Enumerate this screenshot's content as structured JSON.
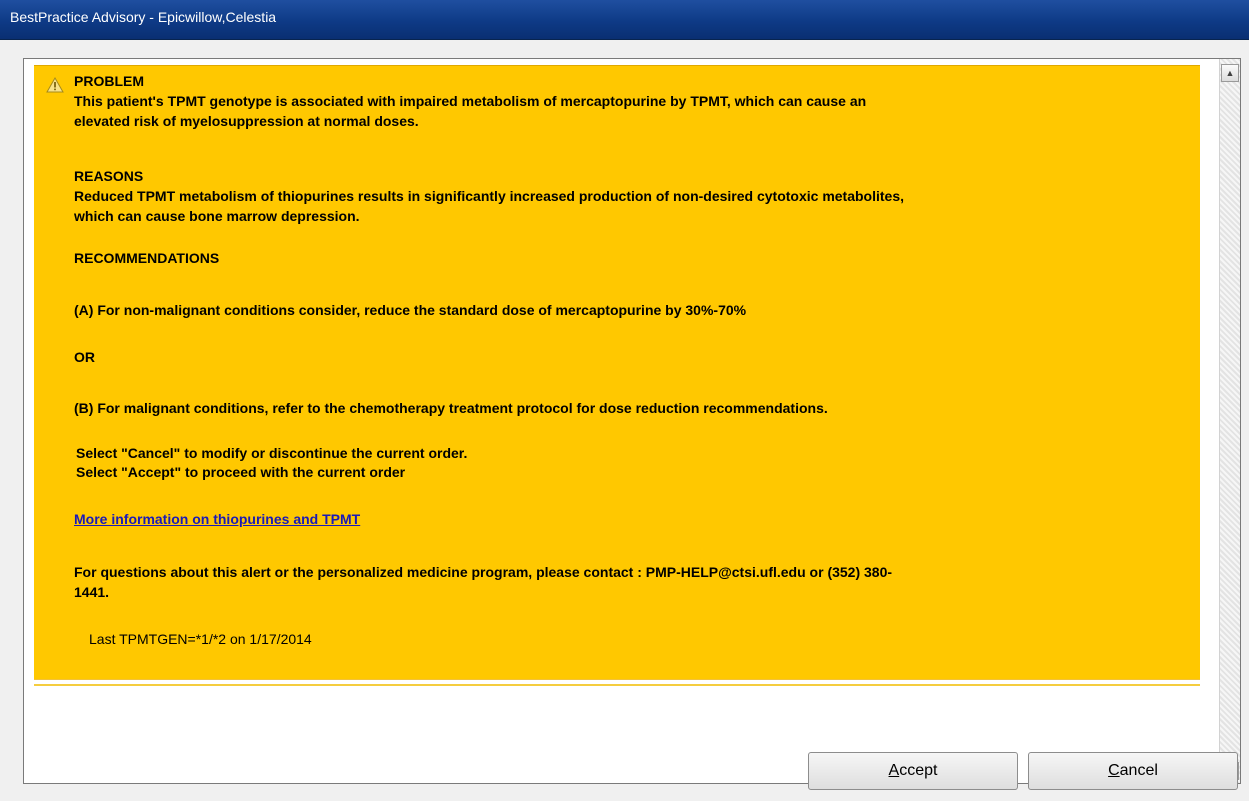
{
  "window": {
    "title": "BestPractice Advisory  - Epicwillow,Celestia"
  },
  "advisory": {
    "problem_heading": "PROBLEM",
    "problem_line1": "This patient's TPMT genotype is associated with impaired metabolism of mercaptopurine by TPMT, which can cause an",
    "problem_line2": "elevated risk of myelosuppression at normal doses.",
    "reasons_heading": "REASONS",
    "reasons_line1": "Reduced TPMT metabolism of thiopurines results in significantly increased production of non-desired cytotoxic metabolites,",
    "reasons_line2": "which can cause bone marrow depression.",
    "recommendations_heading": "RECOMMENDATIONS",
    "rec_a": "(A) For non-malignant conditions consider, reduce the standard dose of mercaptopurine by 30%-70%",
    "or_text": "OR",
    "rec_b": "(B) For malignant conditions, refer to the chemotherapy treatment protocol for dose reduction recommendations.",
    "select_cancel": "Select \"Cancel\" to modify or discontinue the current order.",
    "select_accept": "Select \"Accept\" to proceed with the current order",
    "more_info_link": "More information on thiopurines and TPMT",
    "contact_line1": "For questions about this alert or the personalized medicine program, please contact : PMP-HELP@ctsi.ufl.edu or (352) 380-",
    "contact_line2": "1441.",
    "last_result": "Last TPMTGEN=*1/*2 on 1/17/2014"
  },
  "buttons": {
    "accept_label": "Accept",
    "cancel_label": "Cancel"
  },
  "icons": {
    "warning": "warning-icon",
    "scroll_up": "scroll-up-icon",
    "scroll_down": "scroll-down-icon"
  },
  "colors": {
    "advisory_background": "#ffc800",
    "title_bar": "#0e3a86",
    "link": "#1a1ab8"
  }
}
